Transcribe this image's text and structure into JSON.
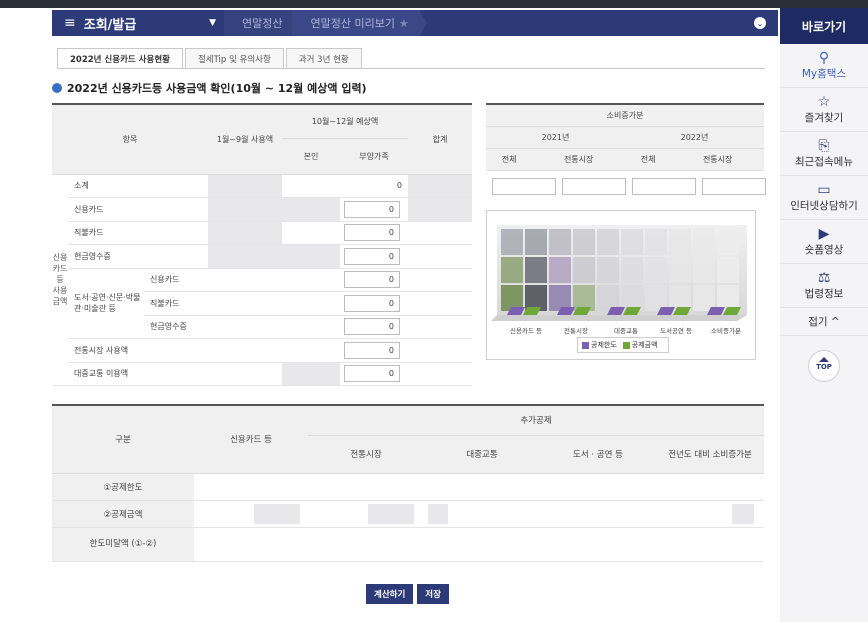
{
  "nav": {
    "menu_title": "조회/발급",
    "crumbs": [
      "연말정산",
      "연말정산 미리보기"
    ]
  },
  "tabs": [
    "2022년 신용카드 사용현황",
    "절세Tip 및 유의사항",
    "과거 3년 현황"
  ],
  "section_title": "2022년 신용카드등 사용금액 확인(10월 ~ 12월 예상액 입력)",
  "table1": {
    "headers": {
      "item": "항목",
      "jan_sep": "1월~9월 사용액",
      "oct_dec": "10월~12월 예상액",
      "self": "본인",
      "dependent": "부양가족",
      "total": "합계"
    },
    "side_label": "신용카드등 사용금액",
    "rows": [
      {
        "label": "소계",
        "value": "0"
      },
      {
        "label": "신용카드",
        "value": "0"
      },
      {
        "label": "직불카드",
        "value": "0"
      },
      {
        "label": "현금영수증",
        "value": "0"
      },
      {
        "group": "도서·공연·신문·박물관·미술관 등",
        "label": "신용카드",
        "value": "0"
      },
      {
        "label": "직불카드",
        "value": "0"
      },
      {
        "label": "현금영수증",
        "value": "0"
      },
      {
        "label": "전통시장 사용액",
        "value": "0"
      },
      {
        "label": "대중교통 이용액",
        "value": "0"
      }
    ]
  },
  "table2": {
    "title": "소비증가분",
    "years": [
      "2021년",
      "2022년"
    ],
    "cols": [
      "전체",
      "전통시장",
      "전체",
      "전통시장"
    ]
  },
  "chart_data": {
    "type": "bar",
    "categories": [
      "신용카드 등",
      "전통시장",
      "대중교통",
      "도서공연 등",
      "소비증가분"
    ],
    "series": [
      {
        "name": "공제한도",
        "values": [],
        "color": "#7b5fb0"
      },
      {
        "name": "공제금액",
        "values": [],
        "color": "#6fa838"
      }
    ]
  },
  "table3": {
    "headers": {
      "group": "구분",
      "credit": "신용카드 등",
      "extra": "추가공제",
      "market": "전통시장",
      "transit": "대중교통",
      "books": "도서 · 공연 등",
      "increase": "전년도 대비 소비증가분"
    },
    "rows": [
      "①공제한도",
      "②공제금액",
      "한도미달액 (①-②)"
    ]
  },
  "buttons": {
    "calc": "계산하기",
    "save": "저장"
  },
  "sidebar": {
    "title": "바로가기",
    "items": [
      "My홈택스",
      "즐겨찾기",
      "최근접속메뉴",
      "인터넷상담하기",
      "숏폼영상",
      "법령정보"
    ],
    "fold": "접기",
    "top": "TOP"
  }
}
